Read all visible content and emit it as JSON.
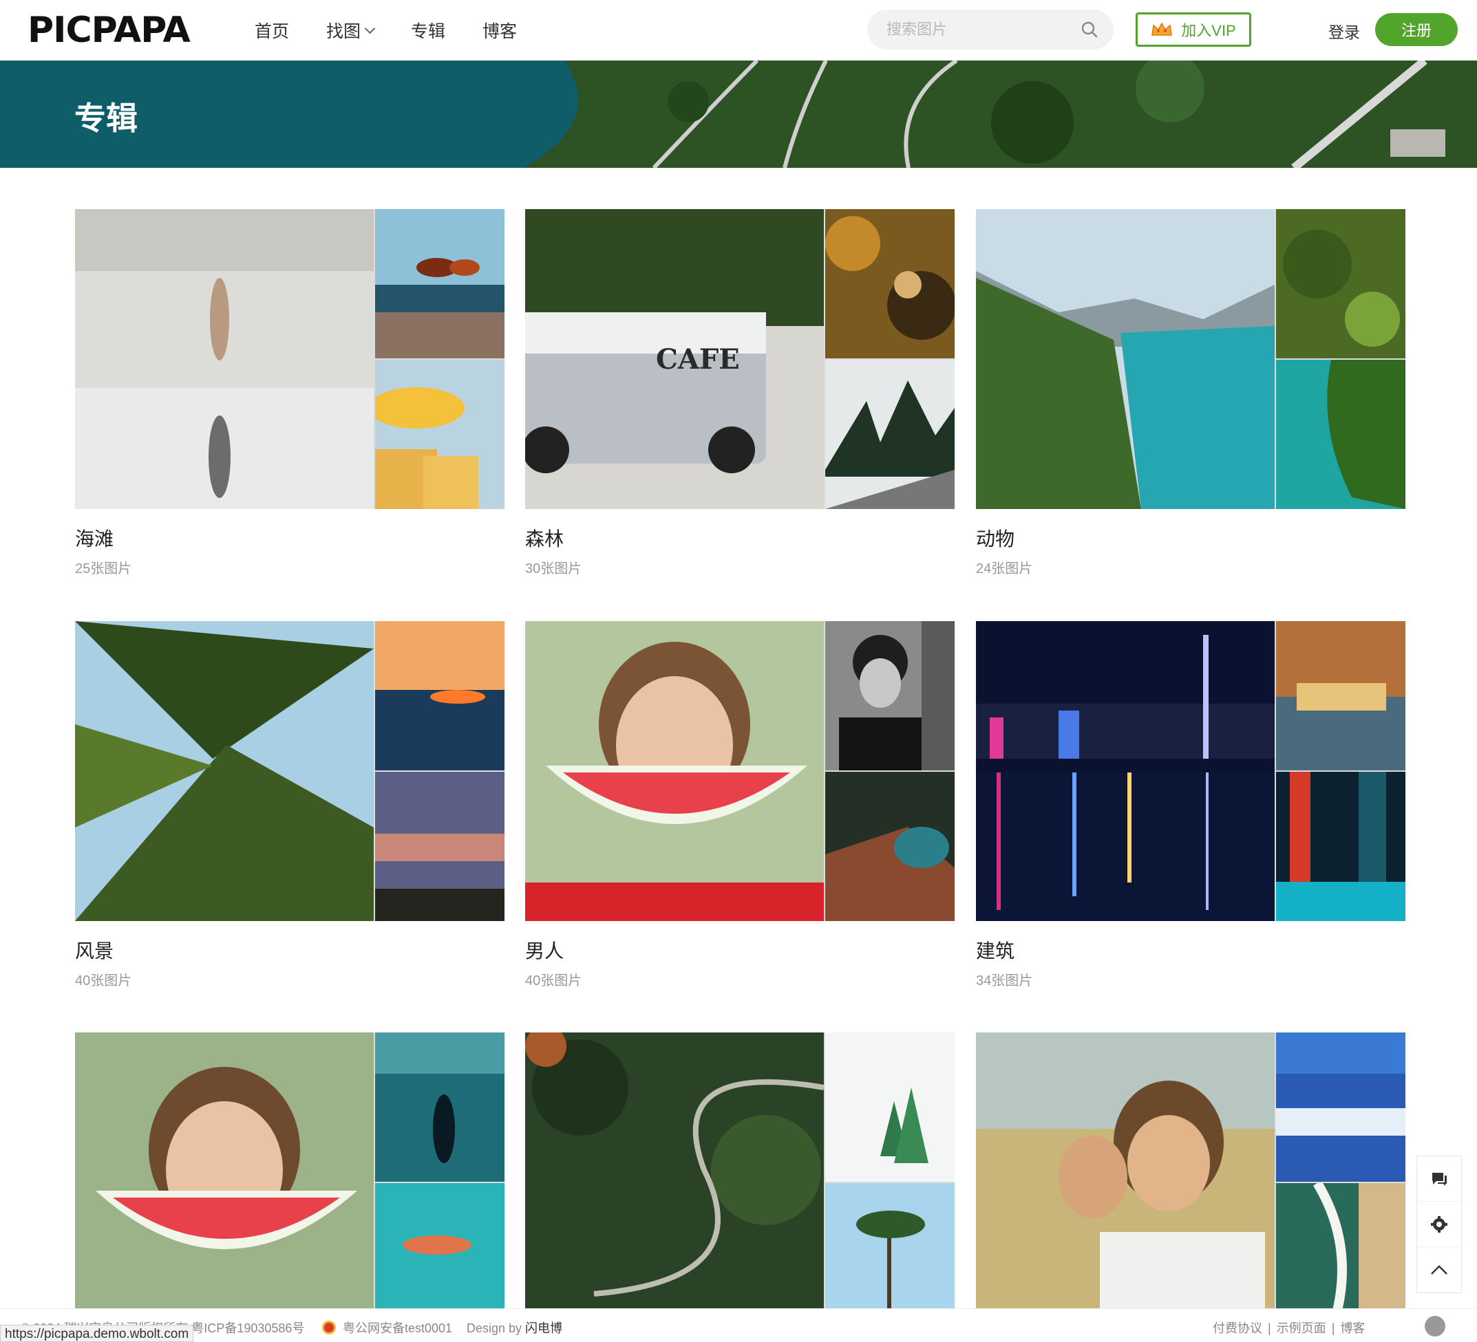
{
  "header": {
    "logo": "PICPAPA",
    "nav": [
      {
        "label": "首页"
      },
      {
        "label": "找图",
        "dropdown": true
      },
      {
        "label": "专辑"
      },
      {
        "label": "博客"
      }
    ],
    "search_placeholder": "搜索图片",
    "vip_label": "加入VIP",
    "login_label": "登录",
    "register_label": "注册",
    "accent_color": "#52a52b"
  },
  "banner": {
    "title": "专辑"
  },
  "albums": [
    {
      "name": "海滩",
      "count": "25张图片"
    },
    {
      "name": "森林",
      "count": "30张图片"
    },
    {
      "name": "动物",
      "count": "24张图片"
    },
    {
      "name": "风景",
      "count": "40张图片"
    },
    {
      "name": "男人",
      "count": "40张图片"
    },
    {
      "name": "建筑",
      "count": "34张图片"
    },
    {
      "name": "",
      "count": ""
    },
    {
      "name": "",
      "count": ""
    },
    {
      "name": "",
      "count": ""
    }
  ],
  "side_tools": [
    "chat-icon",
    "settings-icon",
    "back-to-top-icon"
  ],
  "footer": {
    "copyright": "© 2024 瑞兴宝良公司版权所有 粤ICP备19030586号",
    "police": "粤公网安备test0001",
    "design_prefix": "Design by ",
    "design_name": "闪电博",
    "links": [
      "付费协议",
      "示例页面",
      "博客"
    ]
  },
  "status_url": "https://picpapa.demo.wbolt.com"
}
